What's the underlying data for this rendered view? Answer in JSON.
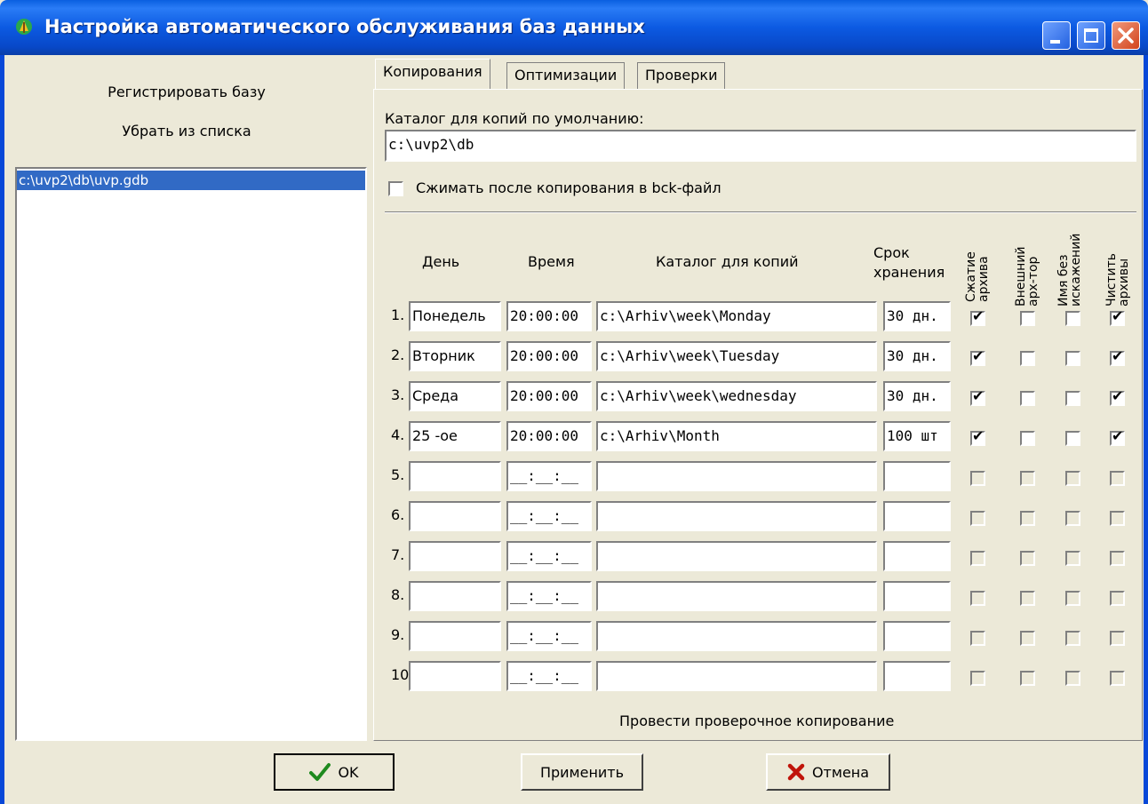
{
  "window": {
    "title": "Настройка автоматического обслуживания баз данных"
  },
  "left": {
    "register_label": "Регистрировать базу",
    "remove_label": "Убрать из списка",
    "db_items": [
      "c:\\uvp2\\db\\uvp.gdb"
    ]
  },
  "tabs": [
    "Копирования",
    "Оптимизации",
    "Проверки"
  ],
  "copy": {
    "default_dir_label": "Каталог для копий по умолчанию:",
    "default_dir_value": "c:\\uvp2\\db",
    "compress_label": "Сжимать после копирования в bck-файл",
    "compress_checked": false,
    "headers": {
      "day": "День",
      "time": "Время",
      "dir": "Каталог для копий",
      "keep": "Срок\nхранения",
      "compress": "Сжатие\nархива",
      "external": "Внешний\nарх-тор",
      "name": "Имя без\nискажений",
      "clean": "Чистить\nархивы"
    },
    "rows": [
      {
        "num": "1.",
        "day": "Понедель",
        "time": "20:00:00",
        "dir": "c:\\Arhiv\\week\\Monday",
        "keep": "30 дн.",
        "c1": true,
        "c2": false,
        "c3": false,
        "c4": true
      },
      {
        "num": "2.",
        "day": "Вторник",
        "time": "20:00:00",
        "dir": "c:\\Arhiv\\week\\Tuesday",
        "keep": "30 дн.",
        "c1": true,
        "c2": false,
        "c3": false,
        "c4": true
      },
      {
        "num": "3.",
        "day": "Среда",
        "time": "20:00:00",
        "dir": "c:\\Arhiv\\week\\wednesday",
        "keep": "30 дн.",
        "c1": true,
        "c2": false,
        "c3": false,
        "c4": true
      },
      {
        "num": "4.",
        "day": "25 -ое",
        "time": "20:00:00",
        "dir": "c:\\Arhiv\\Month",
        "keep": "100 шт",
        "c1": true,
        "c2": false,
        "c3": false,
        "c4": true
      },
      {
        "num": "5.",
        "day": "",
        "time": "__:__:__",
        "dir": "",
        "keep": "",
        "c1": false,
        "c2": false,
        "c3": false,
        "c4": false
      },
      {
        "num": "6.",
        "day": "",
        "time": "__:__:__",
        "dir": "",
        "keep": "",
        "c1": false,
        "c2": false,
        "c3": false,
        "c4": false
      },
      {
        "num": "7.",
        "day": "",
        "time": "__:__:__",
        "dir": "",
        "keep": "",
        "c1": false,
        "c2": false,
        "c3": false,
        "c4": false
      },
      {
        "num": "8.",
        "day": "",
        "time": "__:__:__",
        "dir": "",
        "keep": "",
        "c1": false,
        "c2": false,
        "c3": false,
        "c4": false
      },
      {
        "num": "9.",
        "day": "",
        "time": "__:__:__",
        "dir": "",
        "keep": "",
        "c1": false,
        "c2": false,
        "c3": false,
        "c4": false
      },
      {
        "num": "10.",
        "day": "",
        "time": "__:__:__",
        "dir": "",
        "keep": "",
        "c1": false,
        "c2": false,
        "c3": false,
        "c4": false
      }
    ],
    "test_copy_label": "Провести проверочное копирование"
  },
  "buttons": {
    "ok": "OK",
    "apply": "Применить",
    "cancel": "Отмена"
  },
  "colors": {
    "titlebar": "#0a5fe0",
    "selection": "#316ac5",
    "face": "#ece9d8"
  }
}
